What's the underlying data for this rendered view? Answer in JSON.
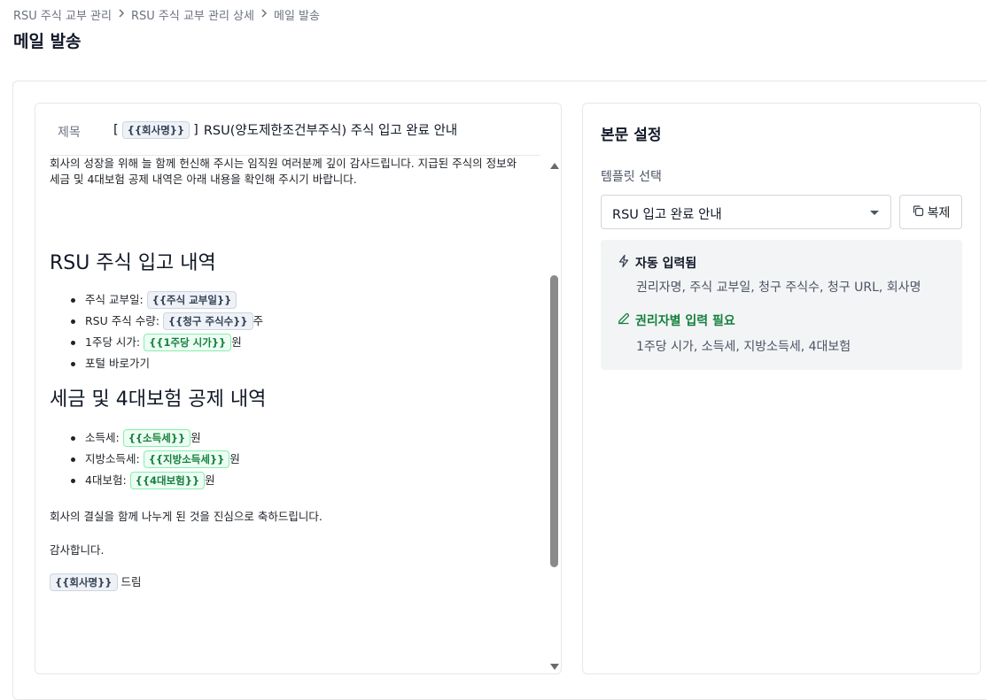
{
  "breadcrumb": {
    "items": [
      "RSU 주식 교부 관리",
      "RSU 주식 교부 관리 상세",
      "메일 발송"
    ],
    "separator": ">"
  },
  "page": {
    "title": "메일 발송"
  },
  "editor": {
    "subject_label": "제목",
    "subject": {
      "prefix": "[",
      "chip": "{{회사명}}",
      "suffix_bracket": "]",
      "text": "RSU(양도제한조건부주식) 주식 입고 완료 안내"
    },
    "body": {
      "cut_line": "회사의 성장을 위해 늘 함께 헌신해 주시는 임직원 여러분께 깊이 감사드립니다. 지급된 주식의 정보와",
      "intro": "세금 및 4대보험 공제 내역은 아래 내용을 확인해 주시기 바랍니다.",
      "section1_title": "RSU 주식 입고 내역",
      "section1_items": [
        {
          "label": "주식 교부일: ",
          "chip": "{{주식 교부일}}",
          "chip_style": "gray",
          "suffix": ""
        },
        {
          "label": "RSU 주식 수량: ",
          "chip": "{{청구 주식수}}",
          "chip_style": "gray",
          "suffix": "주"
        },
        {
          "label": "1주당 시가: ",
          "chip": "{{1주당 시가}}",
          "chip_style": "green",
          "suffix": "원"
        },
        {
          "label": "포털 바로가기",
          "chip": "",
          "chip_style": "",
          "suffix": ""
        }
      ],
      "section2_title": "세금 및 4대보험 공제 내역",
      "section2_items": [
        {
          "label": "소득세: ",
          "chip": "{{소득세}}",
          "chip_style": "green",
          "suffix": "원"
        },
        {
          "label": "지방소득세: ",
          "chip": "{{지방소득세}}",
          "chip_style": "green",
          "suffix": "원"
        },
        {
          "label": "4대보험: ",
          "chip": "{{4대보험}}",
          "chip_style": "green",
          "suffix": "원"
        }
      ],
      "closing": "회사의 결실을 함께 나누게 된 것을 진심으로 축하드립니다.",
      "thanks": "감사합니다.",
      "signature_chip": "{{회사명}}",
      "signature_suffix": " 드림"
    }
  },
  "settings": {
    "title": "본문 설정",
    "template_label": "템플릿 선택",
    "template_selected": "RSU 입고 완료 안내",
    "copy_button": "복제",
    "auto_title": "자동 입력됨",
    "auto_fields": "권리자명, 주식 교부일, 청구 주식수, 청구 URL, 회사명",
    "manual_title": "권리자별 입력 필요",
    "manual_fields": "1주당 시가, 소득세, 지방소득세, 4대보험"
  },
  "colors": {
    "chip_green_text": "#15803d",
    "chip_green_bg": "#ecfdf3",
    "chip_gray_bg": "#eef2f7",
    "manual_title": "#15803d"
  },
  "icons": {
    "breadcrumb_separator": "chevron-right-icon",
    "auto": "lightning-icon",
    "manual": "pencil-icon",
    "copy": "copy-icon",
    "select": "caret-down-icon"
  }
}
